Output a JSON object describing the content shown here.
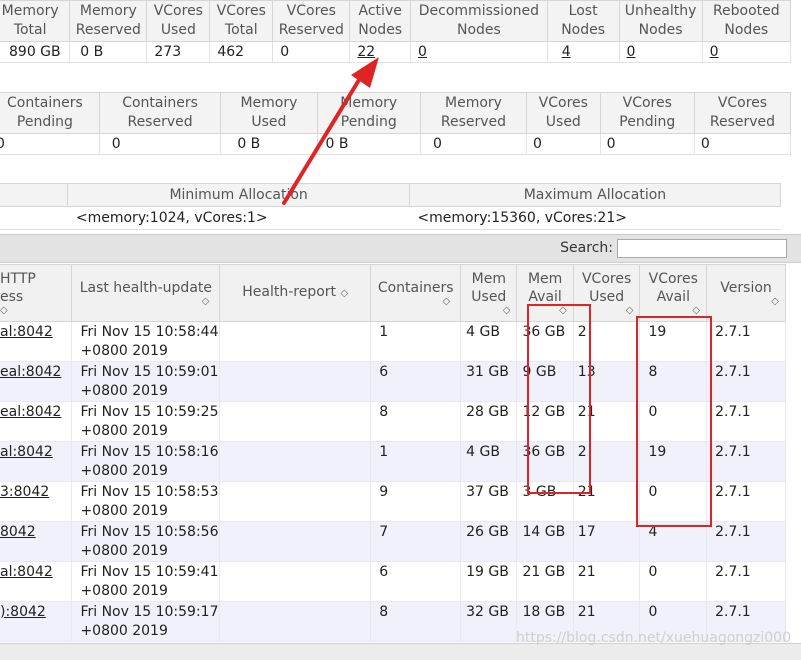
{
  "cluster_metrics": {
    "headers": [
      "Memory Total",
      "Memory Reserved",
      "VCores Used",
      "VCores Total",
      "VCores Reserved",
      "Active Nodes",
      "Decommissioned Nodes",
      "Lost Nodes",
      "Unhealthy Nodes",
      "Rebooted Nodes"
    ],
    "values": [
      "890 GB",
      "0 B",
      "273",
      "462",
      "0",
      "22",
      "0",
      "4",
      "0",
      "0"
    ]
  },
  "queue_metrics": {
    "headers": [
      "Containers Pending",
      "Containers Reserved",
      "Memory Used",
      "Memory Pending",
      "Memory Reserved",
      "VCores Used",
      "VCores Pending",
      "VCores Reserved"
    ],
    "values": [
      "0",
      "0",
      "0 B",
      "0 B",
      "0",
      "0",
      "0",
      "0"
    ]
  },
  "scheduler": {
    "headers": [
      "",
      "Minimum Allocation",
      "Maximum Allocation"
    ],
    "values": [
      "",
      "<memory:1024, vCores:1>",
      "<memory:15360, vCores:21>"
    ]
  },
  "search": {
    "label": "Search:",
    "placeholder": ""
  },
  "nodes_table": {
    "headers": [
      "HTTP         ess",
      "Last health-update",
      "Health-report",
      "Containers",
      "Mem Used",
      "Mem Avail",
      "VCores Used",
      "VCores Avail",
      "Version"
    ],
    "rows": [
      {
        "http": "al:8042",
        "update": "Fri Nov 15 10:58:44 +0800 2019",
        "health": "",
        "containers": "1",
        "mem_used": "4 GB",
        "mem_avail": "36 GB",
        "vc_used": "2",
        "vc_avail": "19",
        "version": "2.7.1"
      },
      {
        "http": "eal:8042",
        "update": "Fri Nov 15 10:59:01 +0800 2019",
        "health": "",
        "containers": "6",
        "mem_used": "31 GB",
        "mem_avail": "9 GB",
        "vc_used": "13",
        "vc_avail": "8",
        "version": "2.7.1"
      },
      {
        "http": "eal:8042",
        "update": "Fri Nov 15 10:59:25 +0800 2019",
        "health": "",
        "containers": "8",
        "mem_used": "28 GB",
        "mem_avail": "12 GB",
        "vc_used": "21",
        "vc_avail": "0",
        "version": "2.7.1"
      },
      {
        "http": "al:8042",
        "update": "Fri Nov 15 10:58:16 +0800 2019",
        "health": "",
        "containers": "1",
        "mem_used": "4 GB",
        "mem_avail": "36 GB",
        "vc_used": "2",
        "vc_avail": "19",
        "version": "2.7.1"
      },
      {
        "http": "3:8042",
        "update": "Fri Nov 15 10:58:53 +0800 2019",
        "health": "",
        "containers": "9",
        "mem_used": "37 GB",
        "mem_avail": "3 GB",
        "vc_used": "21",
        "vc_avail": "0",
        "version": "2.7.1"
      },
      {
        "http": "8042",
        "update": "Fri Nov 15 10:58:56 +0800 2019",
        "health": "",
        "containers": "7",
        "mem_used": "26 GB",
        "mem_avail": "14 GB",
        "vc_used": "17",
        "vc_avail": "4",
        "version": "2.7.1"
      },
      {
        "http": "al:8042",
        "update": "Fri Nov 15 10:59:41 +0800 2019",
        "health": "",
        "containers": "6",
        "mem_used": "19 GB",
        "mem_avail": "21 GB",
        "vc_used": "21",
        "vc_avail": "0",
        "version": "2.7.1"
      },
      {
        "http": "):8042",
        "update": "Fri Nov 15 10:59:17 +0800 2019",
        "health": "",
        "containers": "8",
        "mem_used": "32 GB",
        "mem_avail": "18 GB",
        "vc_used": "21",
        "vc_avail": "0",
        "version": "2.7.1"
      }
    ]
  },
  "annotations": {
    "arrow_color": "#e02424",
    "box_color": "#e02424"
  },
  "watermark": "https://blog.csdn.net/xuehuagongzi000"
}
